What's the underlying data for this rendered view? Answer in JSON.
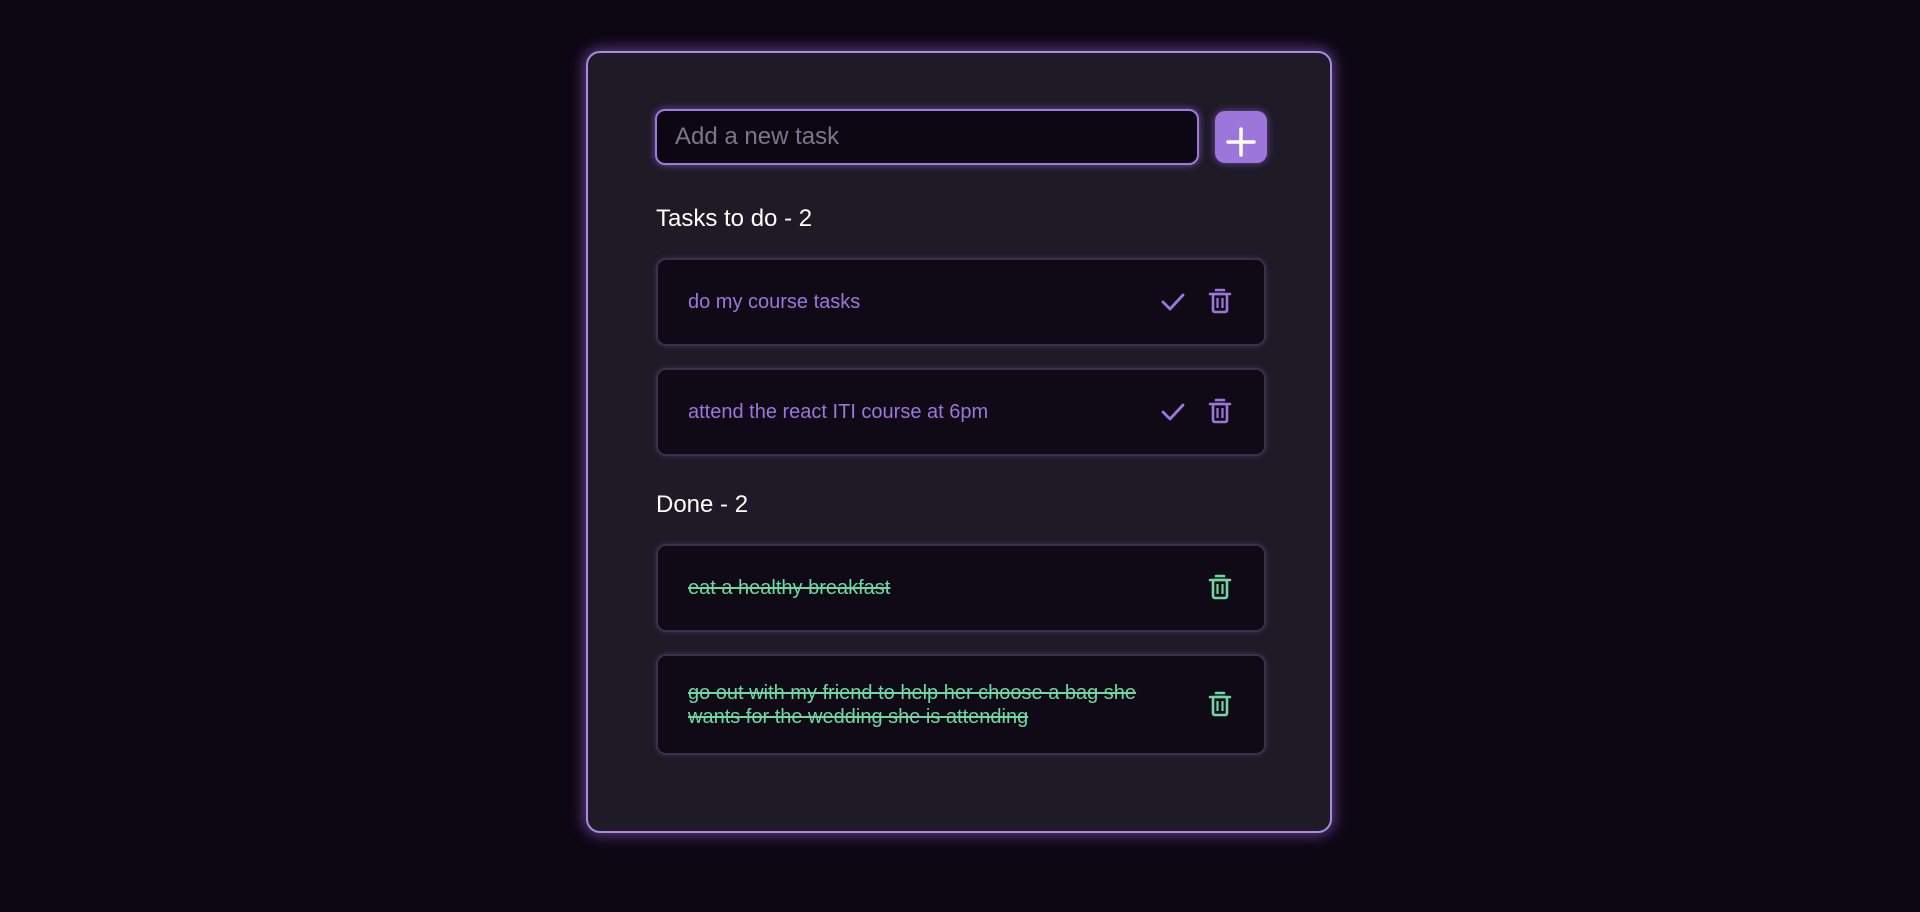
{
  "new_task": {
    "placeholder": "Add a new task",
    "value": ""
  },
  "add_button": {
    "icon": "plus-icon"
  },
  "todo_section": {
    "title": "Tasks to do - 2",
    "tasks": [
      {
        "text": "do my course tasks"
      },
      {
        "text": "attend the react ITI course at 6pm"
      }
    ]
  },
  "done_section": {
    "title": "Done - 2",
    "tasks": [
      {
        "text": "eat a healthy breakfast"
      },
      {
        "text": "go out with my friend to help her choose a bag she wants for the wedding she is attending"
      }
    ]
  },
  "icons": {
    "complete": "check-icon",
    "delete": "trash-icon"
  },
  "colors": {
    "background": "#0d0714",
    "card": "#1e1a26",
    "accent": "#9d76dc",
    "done": "#6fd7a4"
  }
}
